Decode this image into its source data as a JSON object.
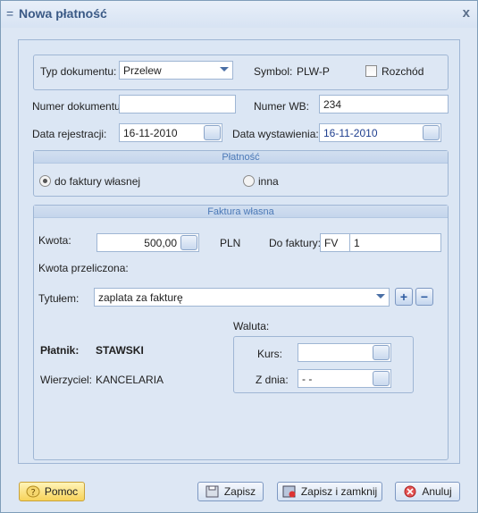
{
  "window": {
    "title": "Nowa płatność",
    "grip_icon": "=",
    "close_icon": "x"
  },
  "form": {
    "typ_dokumentu": {
      "label": "Typ dokumentu:",
      "value": "Przelew"
    },
    "symbol": {
      "label": "Symbol:",
      "value": "PLW-P"
    },
    "rozchod": {
      "label": "Rozchód",
      "checked": false
    },
    "numer_dokumentu": {
      "label": "Numer dokumentu:",
      "value": ""
    },
    "numer_wb": {
      "label": "Numer  WB:",
      "value": "234"
    },
    "data_rejestracji": {
      "label": "Data rejestracji:",
      "value": "16-11-2010"
    },
    "data_wystawienia": {
      "label": "Data wystawienia:",
      "value": "16-11-2010"
    }
  },
  "platnosc": {
    "header": "Płatność",
    "options": [
      {
        "label": "do faktury własnej",
        "selected": true
      },
      {
        "label": "inna",
        "selected": false
      }
    ]
  },
  "faktura": {
    "header": "Faktura własna",
    "kwota_label": "Kwota:",
    "kwota_value": "500,00",
    "currency": "PLN",
    "do_faktury_label": "Do faktury:",
    "do_faktury_prefix": "FV",
    "do_faktury_number": "1",
    "kwota_przeliczona_label": "Kwota przeliczona:",
    "tytulem_label": "Tytułem:",
    "tytulem_value": "zaplata za fakturę",
    "add_label": "+",
    "remove_label": "−",
    "waluta_label": "Waluta:",
    "kurs_label": "Kurs:",
    "kurs_value": "",
    "z_dnia_label": "Z dnia:",
    "z_dnia_value": " -  -",
    "platnik_label": "Płatnik:",
    "platnik_value": "STAWSKI",
    "wierzyciel_label": "Wierzyciel:",
    "wierzyciel_value": "KANCELARIA"
  },
  "buttons": {
    "pomoc": "Pomoc",
    "zapisz": "Zapisz",
    "zapisz_zamknij": "Zapisz i zamknij",
    "anuluj": "Anuluj"
  },
  "colors": {
    "accent": "#4b79b7",
    "background": "#dde7f4"
  }
}
